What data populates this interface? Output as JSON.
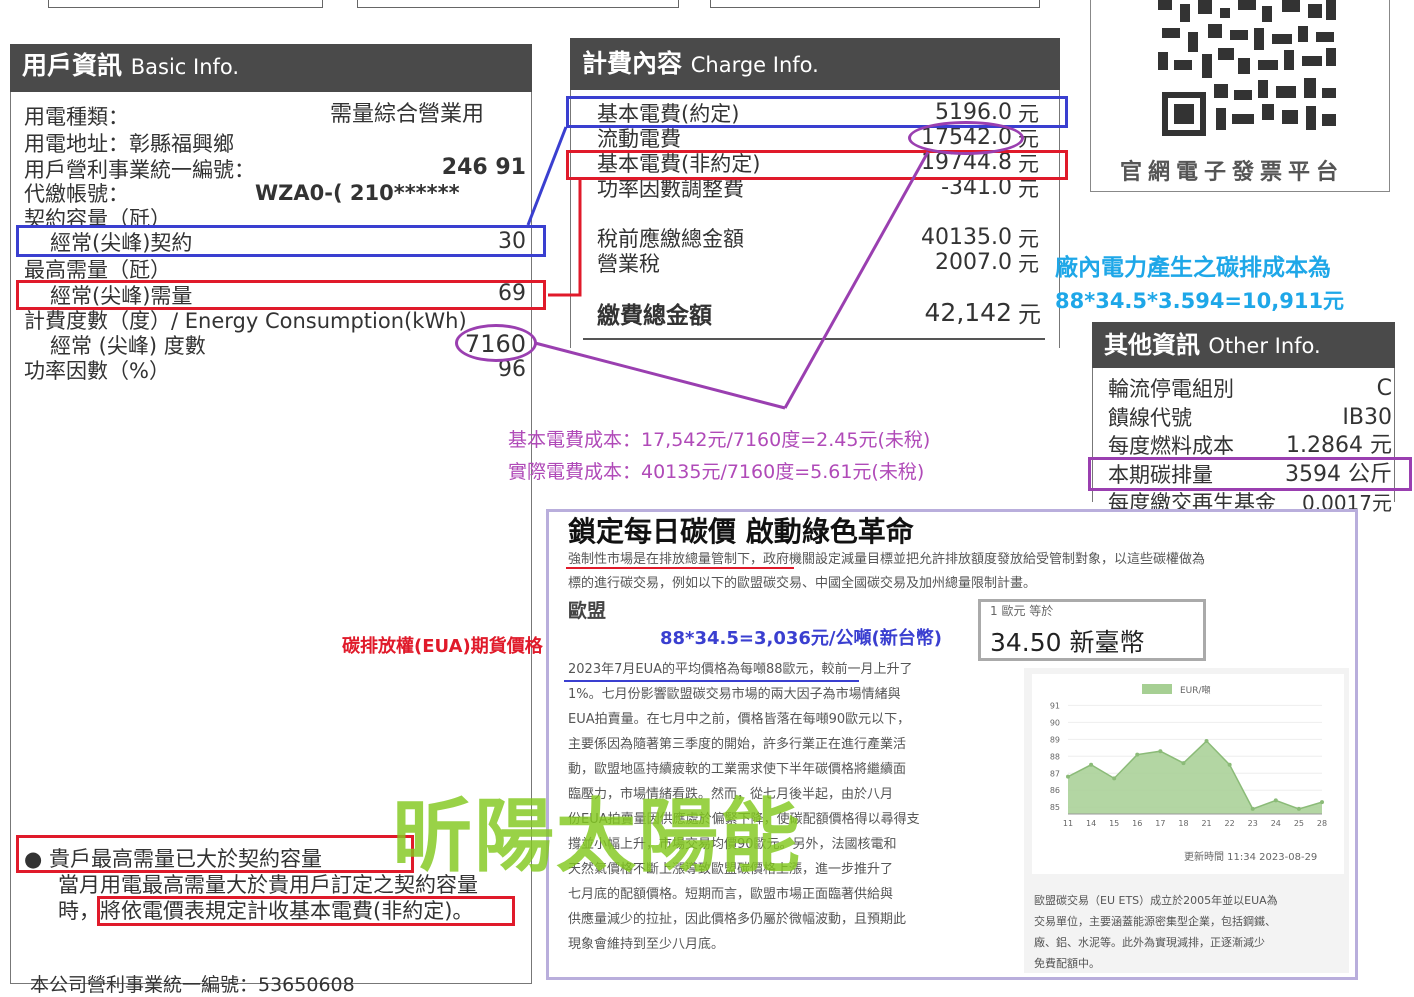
{
  "basic_info": {
    "header": "用戶資訊",
    "header_en": "Basic Info.",
    "rows": [
      {
        "label": "用電種類：",
        "value": "需量綜合營業用"
      },
      {
        "label": "用電地址：彰縣福興鄉",
        "value": ""
      },
      {
        "label": "用戶營利事業統一編號：",
        "value": "246     91"
      },
      {
        "label": "代繳帳號：",
        "value": "WZA0-(          210******"
      },
      {
        "label": "契約容量（瓩）",
        "value": ""
      },
      {
        "label": "經常(尖峰)契約",
        "value": "30"
      },
      {
        "label": "最高需量（瓩）",
        "value": ""
      },
      {
        "label": "經常(尖峰)需量",
        "value": "69"
      },
      {
        "label": "計費度數（度）/ Energy Consumption(kWh)",
        "value": ""
      },
      {
        "label": "經常 (尖峰) 度數",
        "value": "7160"
      },
      {
        "label": "功率因數（%）",
        "value": "96"
      }
    ],
    "notice_1": "● 貴戶最高需量已大於契約容量",
    "notice_2": "當月用電最高需量大於貴用戶訂定之契約容量",
    "notice_3": "時，將依電價表規定計收基本電費(非約定)。",
    "footer": "本公司營利事業統一編號：53650608"
  },
  "charge_info": {
    "header": "計費內容",
    "header_en": "Charge Info.",
    "rows": [
      {
        "label": "基本電費(約定)",
        "value": "5196.0",
        "unit": "元"
      },
      {
        "label": "流動電費",
        "value": "17542.0",
        "unit": "元"
      },
      {
        "label": "基本電費(非約定)",
        "value": "19744.8",
        "unit": "元"
      },
      {
        "label": "功率因數調整費",
        "value": "-341.0",
        "unit": "元"
      },
      {
        "label": "稅前應繳總金額",
        "value": "40135.0",
        "unit": "元"
      },
      {
        "label": "營業稅",
        "value": "2007.0",
        "unit": "元"
      }
    ],
    "total_label": "繳費總金額",
    "total_value": "42,142",
    "total_unit": "元"
  },
  "qr": {
    "caption": "官網電子發票平台"
  },
  "other_info": {
    "header": "其他資訊",
    "header_en": "Other Info.",
    "rows": [
      {
        "label": "輪流停電組別",
        "value": "C"
      },
      {
        "label": "饋線代號",
        "value": "IB30"
      },
      {
        "label": "每度燃料成本",
        "value": "1.2864 元"
      },
      {
        "label": "本期碳排量",
        "value": "3594 公斤"
      },
      {
        "label": "每度繳交再生基金",
        "value": "0.0017元"
      }
    ]
  },
  "annotations": {
    "carbon_cost_title": "廠內電力產生之碳排成本為",
    "carbon_cost_formula": "88*34.5*3.594=10,911元",
    "basic_cost": "基本電費成本：17,542元/7160度=2.45元(未稅)",
    "actual_cost": "實際電費成本：40135元/7160度=5.61元(未稅)",
    "eua_label": "碳排放權(EUA)期貨價格",
    "eua_formula": "88*34.5=3,036元/公噸(新台幣)",
    "watermark": "昕陽太陽能"
  },
  "article": {
    "title": "鎖定每日碳價 啟動綠色革命",
    "intro_1": "強制性市場是在排放總量管制下，政府機關設定減量目標並把允許排放額度發放給受管制對象，以這些碳權做為",
    "intro_2": "標的進行碳交易，例如以下的歐盟碳交易、中國全國碳交易及加州總量限制計畫。",
    "section": "歐盟",
    "exchange_label": "1 歐元 等於",
    "exchange_value": "34.50 新臺幣",
    "body_lines": [
      "2023年7月EUA的平均價格為每噸88歐元，較前一月上升了",
      "1%。七月份影響歐盟碳交易市場的兩大因子為市場情緒與",
      "EUA拍賣量。在七月中之前，價格皆落在每噸90歐元以下，",
      "主要係因為隨著第三季度的開始，許多行業正在進行產業活",
      "動，歐盟地區持續疲軟的工業需求使下半年碳價格將繼續面",
      "臨壓力，市場情緒看跌。然而，從七月後半起，由於八月",
      "份EUA拍賣量因供應處於偏緊下降，使碳配額價格得以尋得支",
      "撐並小幅上升，市場交易均價90歐元。另外，法國核電和",
      "天然氣價格不斷上漲導致歐盟碳價格上漲，進一步推升了",
      "七月底的配額價格。短期而言，歐盟市場正面臨著供給與",
      "供應量減少的拉扯，因此價格多仍屬於微幅波動，且預期此",
      "現象會維持到至少八月底。"
    ],
    "chart_caption_1": "歐盟碳交易（EU ETS）成立於2005年並以EUA為",
    "chart_caption_2": "交易單位，主要涵蓋能源密集型企業，包括鋼鐵、",
    "chart_caption_3": "廠、鋁、水泥等。此外為實現減排，正逐漸減少",
    "chart_caption_4": "免費配額中。",
    "chart_updated": "更新時間 11:34 2023-08-29"
  },
  "chart_data": {
    "type": "area",
    "title": "",
    "legend": [
      "EUR/噸"
    ],
    "legend_position": "top",
    "x_tick_labels": [
      "11",
      "14",
      "15",
      "16",
      "17",
      "18",
      "21",
      "22",
      "23",
      "24",
      "25",
      "28"
    ],
    "y_tick_labels": [
      "91",
      "90",
      "89",
      "88",
      "87",
      "86",
      "85"
    ],
    "ylim": [
      84.6,
      91.2
    ],
    "series": [
      {
        "name": "EUR/噸",
        "values": [
          86.8,
          87.5,
          86.7,
          88.1,
          88.3,
          87.6,
          88.9,
          87.5,
          84.9,
          85.4,
          84.9,
          85.3
        ]
      }
    ],
    "color": "#a6cf93",
    "grid": true
  }
}
